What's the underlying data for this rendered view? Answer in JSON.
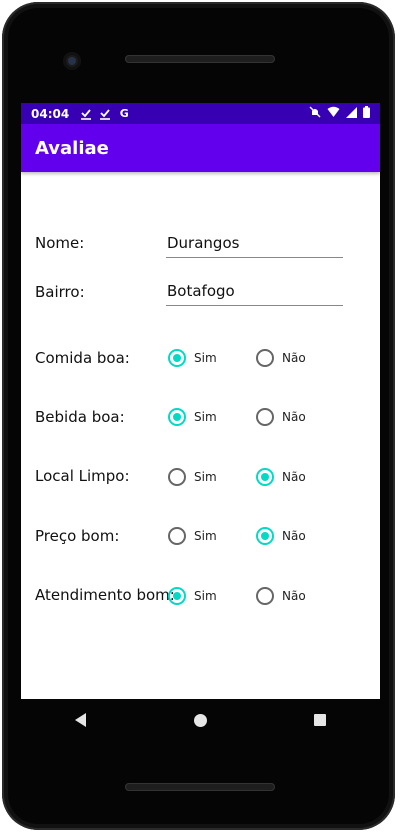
{
  "statusbar": {
    "time": "04:04",
    "notification_icons": [
      "download-done-icon",
      "download-done-icon",
      "google-icon"
    ],
    "google_glyph": "G",
    "right_icons": [
      "mute-icon",
      "wifi-icon",
      "signal-icon",
      "battery-icon"
    ]
  },
  "appbar": {
    "title": "Avaliae"
  },
  "form": {
    "nome": {
      "label": "Nome:",
      "value": "Durangos"
    },
    "bairro": {
      "label": "Bairro:",
      "value": "Botafogo"
    },
    "questions": [
      {
        "label": "Comida boa:",
        "yes": "Sim",
        "no": "Não",
        "selected": "yes"
      },
      {
        "label": "Bebida boa:",
        "yes": "Sim",
        "no": "Não",
        "selected": "yes"
      },
      {
        "label": "Local Limpo:",
        "yes": "Sim",
        "no": "Não",
        "selected": "no"
      },
      {
        "label": "Preço bom:",
        "yes": "Sim",
        "no": "Não",
        "selected": "no"
      },
      {
        "label": "Atendimento bom:",
        "yes": "Sim",
        "no": "Não",
        "selected": "yes"
      }
    ]
  },
  "colors": {
    "status_bar": "#3700B3",
    "app_bar": "#6200EE",
    "radio_accent": "#03DAC5"
  }
}
